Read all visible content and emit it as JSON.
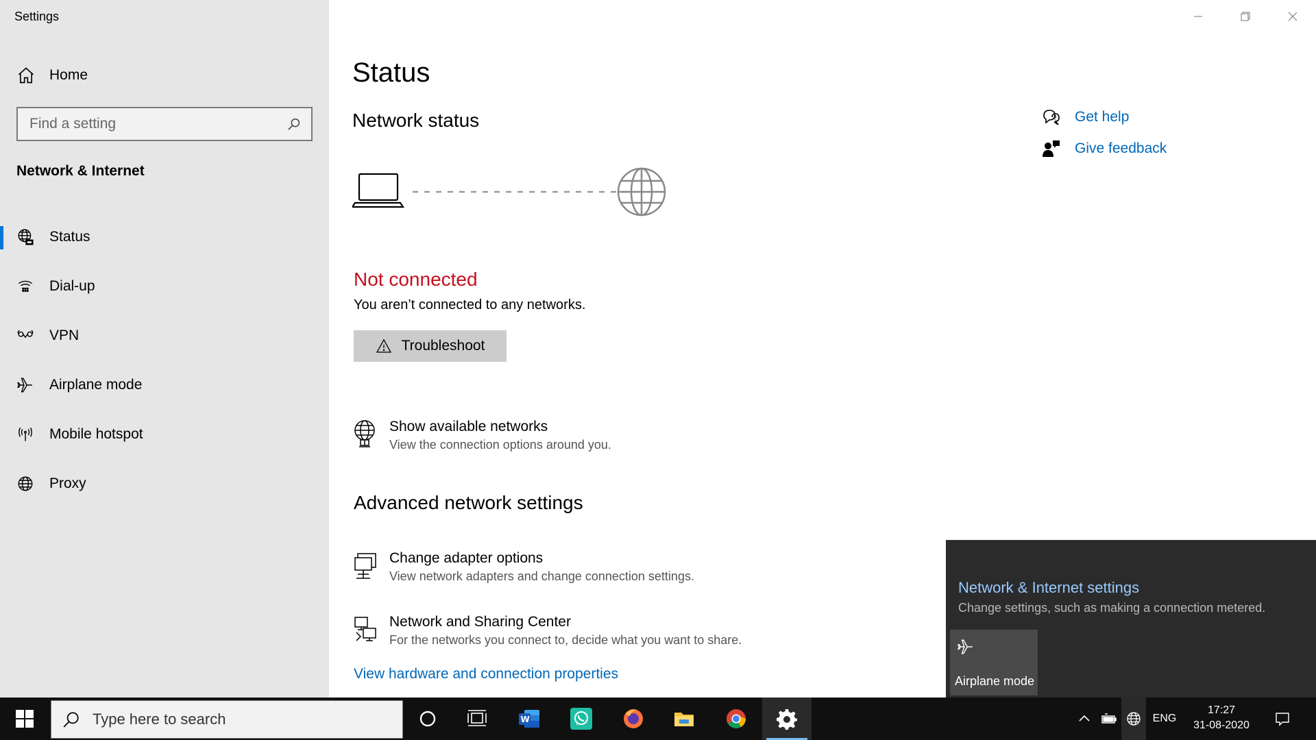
{
  "window": {
    "title": "Settings"
  },
  "sidebar": {
    "home_label": "Home",
    "search_placeholder": "Find a setting",
    "section_title": "Network & Internet",
    "items": [
      {
        "label": "Status",
        "icon": "globe-network-icon",
        "active": true
      },
      {
        "label": "Dial-up",
        "icon": "dialup-icon",
        "active": false
      },
      {
        "label": "VPN",
        "icon": "vpn-icon",
        "active": false
      },
      {
        "label": "Airplane mode",
        "icon": "airplane-icon",
        "active": false
      },
      {
        "label": "Mobile hotspot",
        "icon": "hotspot-icon",
        "active": false
      },
      {
        "label": "Proxy",
        "icon": "globe-icon",
        "active": false
      }
    ]
  },
  "main": {
    "page_title": "Status",
    "network_status_title": "Network status",
    "status_heading": "Not connected",
    "status_text": "You aren’t connected to any networks.",
    "troubleshoot_label": "Troubleshoot",
    "show_networks": {
      "title": "Show available networks",
      "subtitle": "View the connection options around you."
    },
    "advanced_title": "Advanced network settings",
    "adapter": {
      "title": "Change adapter options",
      "subtitle": "View network adapters and change connection settings."
    },
    "sharing": {
      "title": "Network and Sharing Center",
      "subtitle": "For the networks you connect to, decide what you want to share."
    },
    "hardware_link": "View hardware and connection properties",
    "get_help": "Get help",
    "give_feedback": "Give feedback"
  },
  "flyout": {
    "title": "Network & Internet settings",
    "subtitle": "Change settings, such as making a connection metered.",
    "tile_label": "Airplane mode"
  },
  "taskbar": {
    "search_placeholder": "Type here to search",
    "language": "ENG",
    "time": "17:27",
    "date": "31-08-2020"
  },
  "colors": {
    "accent": "#0078d7",
    "link": "#0067b8",
    "error": "#c50f1f",
    "sidebar_bg": "#e6e6e6",
    "taskbar_bg": "#101010",
    "flyout_bg": "#2b2b2b"
  }
}
